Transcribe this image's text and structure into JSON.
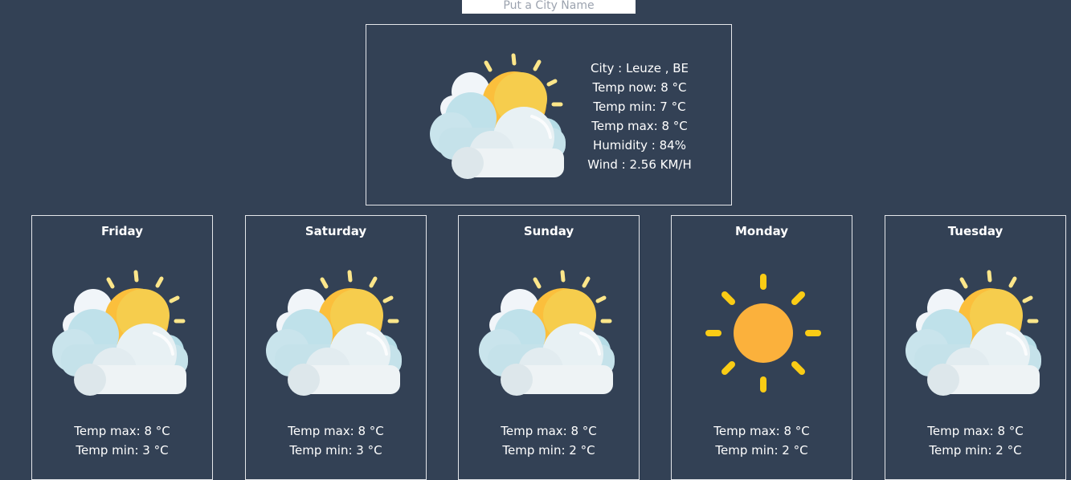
{
  "search": {
    "placeholder": "Put a City Name"
  },
  "current": {
    "icon": "sun-behind-clouds-icon",
    "city": "City : Leuze , BE",
    "temp_now": "Temp now: 8 °C",
    "temp_min": "Temp min: 7 °C",
    "temp_max": "Temp max: 8 °C",
    "humidity": "Humidity : 84%",
    "wind": "Wind : 2.56 KM/H"
  },
  "forecast": [
    {
      "day": "Friday",
      "icon": "sun-behind-clouds-icon",
      "temp_max": "Temp max: 8 °C",
      "temp_min": "Temp min: 3 °C"
    },
    {
      "day": "Saturday",
      "icon": "sun-behind-clouds-icon",
      "temp_max": "Temp max: 8 °C",
      "temp_min": "Temp min: 3 °C"
    },
    {
      "day": "Sunday",
      "icon": "sun-behind-clouds-icon",
      "temp_max": "Temp max: 8 °C",
      "temp_min": "Temp min: 2 °C"
    },
    {
      "day": "Monday",
      "icon": "sun-icon",
      "temp_max": "Temp max: 8 °C",
      "temp_min": "Temp min: 2 °C"
    },
    {
      "day": "Tuesday",
      "icon": "sun-behind-clouds-icon",
      "temp_max": "Temp max: 8 °C",
      "temp_min": "Temp min: 2 °C"
    }
  ]
}
